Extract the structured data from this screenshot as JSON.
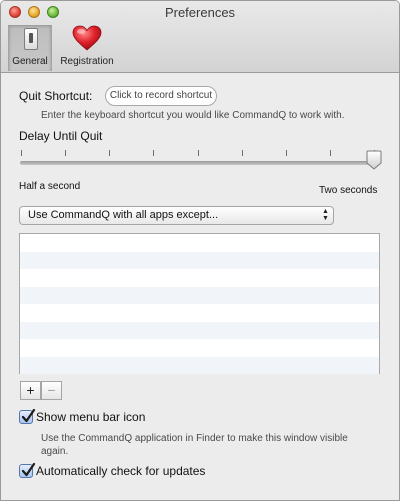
{
  "window": {
    "title": "Preferences"
  },
  "toolbar": {
    "general_label": "General",
    "registration_label": "Registration"
  },
  "quit_shortcut": {
    "label": "Quit Shortcut:",
    "placeholder": "Click to record shortcut",
    "hint": "Enter the keyboard shortcut you would like CommandQ to work with."
  },
  "delay": {
    "label": "Delay Until Quit",
    "min_label": "Half a second",
    "max_label": "Two seconds",
    "value_fraction": 1.0,
    "tick_count": 9
  },
  "apps_popup": {
    "selected": "Use CommandQ with all apps except..."
  },
  "apps_list": {
    "rows": []
  },
  "list_buttons": {
    "add_label": "+",
    "remove_label": "−"
  },
  "menu_bar_icon": {
    "label": "Show menu bar icon",
    "checked": true,
    "hint_line1": "Use the CommandQ application in Finder to make this window visible",
    "hint_line2": "again."
  },
  "updates": {
    "label": "Automatically check for updates",
    "checked": true
  },
  "colors": {
    "checkbox_fill": "#a7c4f0",
    "list_stripe": "#f1f5fa",
    "heart": "#e0212b"
  }
}
